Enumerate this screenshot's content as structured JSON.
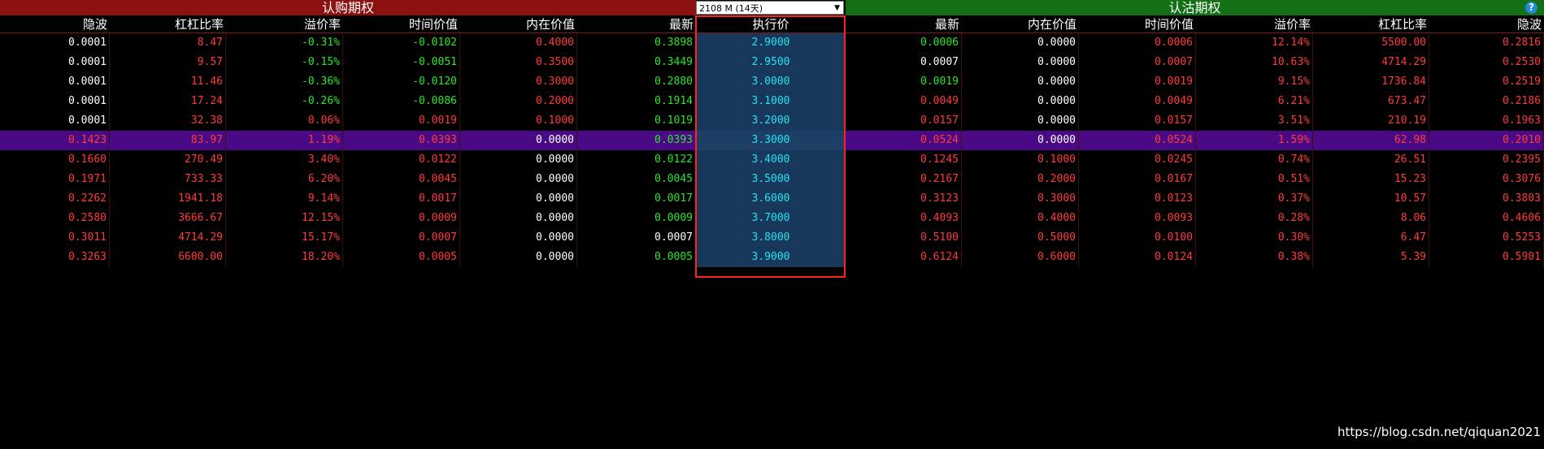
{
  "header": {
    "call_title": "认购期权",
    "put_title": "认沽期权",
    "month_select_value": "2108 M (14天)",
    "help_glyph": "?"
  },
  "columns": {
    "call": [
      "隐波",
      "杠杠比率",
      "溢价率",
      "时间价值",
      "内在价值",
      "最新"
    ],
    "strike": "执行价",
    "put": [
      "最新",
      "内在价值",
      "时间价值",
      "溢价率",
      "杠杠比率",
      "隐波"
    ]
  },
  "rows": [
    {
      "call": [
        "0.0001",
        "8.47",
        "-0.31%",
        "-0.0102",
        "0.4000",
        "0.3898"
      ],
      "call_colors": [
        "white",
        "red",
        "green",
        "green",
        "red",
        "green"
      ],
      "strike": "2.9000",
      "put": [
        "0.0006",
        "0.0000",
        "0.0006",
        "12.14%",
        "5500.00",
        "0.2816"
      ],
      "put_colors": [
        "green",
        "white",
        "red",
        "red",
        "red",
        "red"
      ]
    },
    {
      "call": [
        "0.0001",
        "9.57",
        "-0.15%",
        "-0.0051",
        "0.3500",
        "0.3449"
      ],
      "call_colors": [
        "white",
        "red",
        "green",
        "green",
        "red",
        "green"
      ],
      "strike": "2.9500",
      "put": [
        "0.0007",
        "0.0000",
        "0.0007",
        "10.63%",
        "4714.29",
        "0.2530"
      ],
      "put_colors": [
        "white",
        "white",
        "red",
        "red",
        "red",
        "red"
      ]
    },
    {
      "call": [
        "0.0001",
        "11.46",
        "-0.36%",
        "-0.0120",
        "0.3000",
        "0.2880"
      ],
      "call_colors": [
        "white",
        "red",
        "green",
        "green",
        "red",
        "green"
      ],
      "strike": "3.0000",
      "put": [
        "0.0019",
        "0.0000",
        "0.0019",
        "9.15%",
        "1736.84",
        "0.2519"
      ],
      "put_colors": [
        "green",
        "white",
        "red",
        "red",
        "red",
        "red"
      ]
    },
    {
      "call": [
        "0.0001",
        "17.24",
        "-0.26%",
        "-0.0086",
        "0.2000",
        "0.1914"
      ],
      "call_colors": [
        "white",
        "red",
        "green",
        "green",
        "red",
        "green"
      ],
      "strike": "3.1000",
      "put": [
        "0.0049",
        "0.0000",
        "0.0049",
        "6.21%",
        "673.47",
        "0.2186"
      ],
      "put_colors": [
        "red",
        "white",
        "red",
        "red",
        "red",
        "red"
      ]
    },
    {
      "call": [
        "0.0001",
        "32.38",
        "0.06%",
        "0.0019",
        "0.1000",
        "0.1019"
      ],
      "call_colors": [
        "white",
        "red",
        "red",
        "red",
        "red",
        "green"
      ],
      "strike": "3.2000",
      "put": [
        "0.0157",
        "0.0000",
        "0.0157",
        "3.51%",
        "210.19",
        "0.1963"
      ],
      "put_colors": [
        "red",
        "white",
        "red",
        "red",
        "red",
        "red"
      ]
    },
    {
      "call": [
        "0.1423",
        "83.97",
        "1.19%",
        "0.0393",
        "0.0000",
        "0.0393"
      ],
      "call_colors": [
        "red",
        "red",
        "red",
        "red",
        "white",
        "green"
      ],
      "strike": "3.3000",
      "put": [
        "0.0524",
        "0.0000",
        "0.0524",
        "1.59%",
        "62.98",
        "0.2010"
      ],
      "put_colors": [
        "red",
        "white",
        "red",
        "red",
        "red",
        "red"
      ],
      "selected": true
    },
    {
      "call": [
        "0.1660",
        "270.49",
        "3.40%",
        "0.0122",
        "0.0000",
        "0.0122"
      ],
      "call_colors": [
        "red",
        "red",
        "red",
        "red",
        "white",
        "green"
      ],
      "strike": "3.4000",
      "put": [
        "0.1245",
        "0.1000",
        "0.0245",
        "0.74%",
        "26.51",
        "0.2395"
      ],
      "put_colors": [
        "red",
        "red",
        "red",
        "red",
        "red",
        "red"
      ]
    },
    {
      "call": [
        "0.1971",
        "733.33",
        "6.20%",
        "0.0045",
        "0.0000",
        "0.0045"
      ],
      "call_colors": [
        "red",
        "red",
        "red",
        "red",
        "white",
        "green"
      ],
      "strike": "3.5000",
      "put": [
        "0.2167",
        "0.2000",
        "0.0167",
        "0.51%",
        "15.23",
        "0.3076"
      ],
      "put_colors": [
        "red",
        "red",
        "red",
        "red",
        "red",
        "red"
      ]
    },
    {
      "call": [
        "0.2262",
        "1941.18",
        "9.14%",
        "0.0017",
        "0.0000",
        "0.0017"
      ],
      "call_colors": [
        "red",
        "red",
        "red",
        "red",
        "white",
        "green"
      ],
      "strike": "3.6000",
      "put": [
        "0.3123",
        "0.3000",
        "0.0123",
        "0.37%",
        "10.57",
        "0.3803"
      ],
      "put_colors": [
        "red",
        "red",
        "red",
        "red",
        "red",
        "red"
      ]
    },
    {
      "call": [
        "0.2580",
        "3666.67",
        "12.15%",
        "0.0009",
        "0.0000",
        "0.0009"
      ],
      "call_colors": [
        "red",
        "red",
        "red",
        "red",
        "white",
        "green"
      ],
      "strike": "3.7000",
      "put": [
        "0.4093",
        "0.4000",
        "0.0093",
        "0.28%",
        "8.06",
        "0.4606"
      ],
      "put_colors": [
        "red",
        "red",
        "red",
        "red",
        "red",
        "red"
      ]
    },
    {
      "call": [
        "0.3011",
        "4714.29",
        "15.17%",
        "0.0007",
        "0.0000",
        "0.0007"
      ],
      "call_colors": [
        "red",
        "red",
        "red",
        "red",
        "white",
        "white"
      ],
      "strike": "3.8000",
      "put": [
        "0.5100",
        "0.5000",
        "0.0100",
        "0.30%",
        "6.47",
        "0.5253"
      ],
      "put_colors": [
        "red",
        "red",
        "red",
        "red",
        "red",
        "red"
      ]
    },
    {
      "call": [
        "0.3263",
        "6600.00",
        "18.20%",
        "0.0005",
        "0.0000",
        "0.0005"
      ],
      "call_colors": [
        "red",
        "red",
        "red",
        "red",
        "white",
        "green"
      ],
      "strike": "3.9000",
      "put": [
        "0.6124",
        "0.6000",
        "0.0124",
        "0.38%",
        "5.39",
        "0.5901"
      ],
      "put_colors": [
        "red",
        "red",
        "red",
        "red",
        "red",
        "red"
      ]
    }
  ],
  "watermark": "https://blog.csdn.net/qiquan2021",
  "colors": {
    "call_banner": "#8c1111",
    "put_banner": "#137016",
    "selected_row": "#4a0a86",
    "strike_bg": "#17385a",
    "strike_text": "#25e2f0",
    "up": "#ff3b3b",
    "down": "#2ce62c",
    "highlight_box": "#ff2020"
  },
  "icons": {
    "month_select_arrow": "chevron-down-icon",
    "help": "help-icon"
  }
}
